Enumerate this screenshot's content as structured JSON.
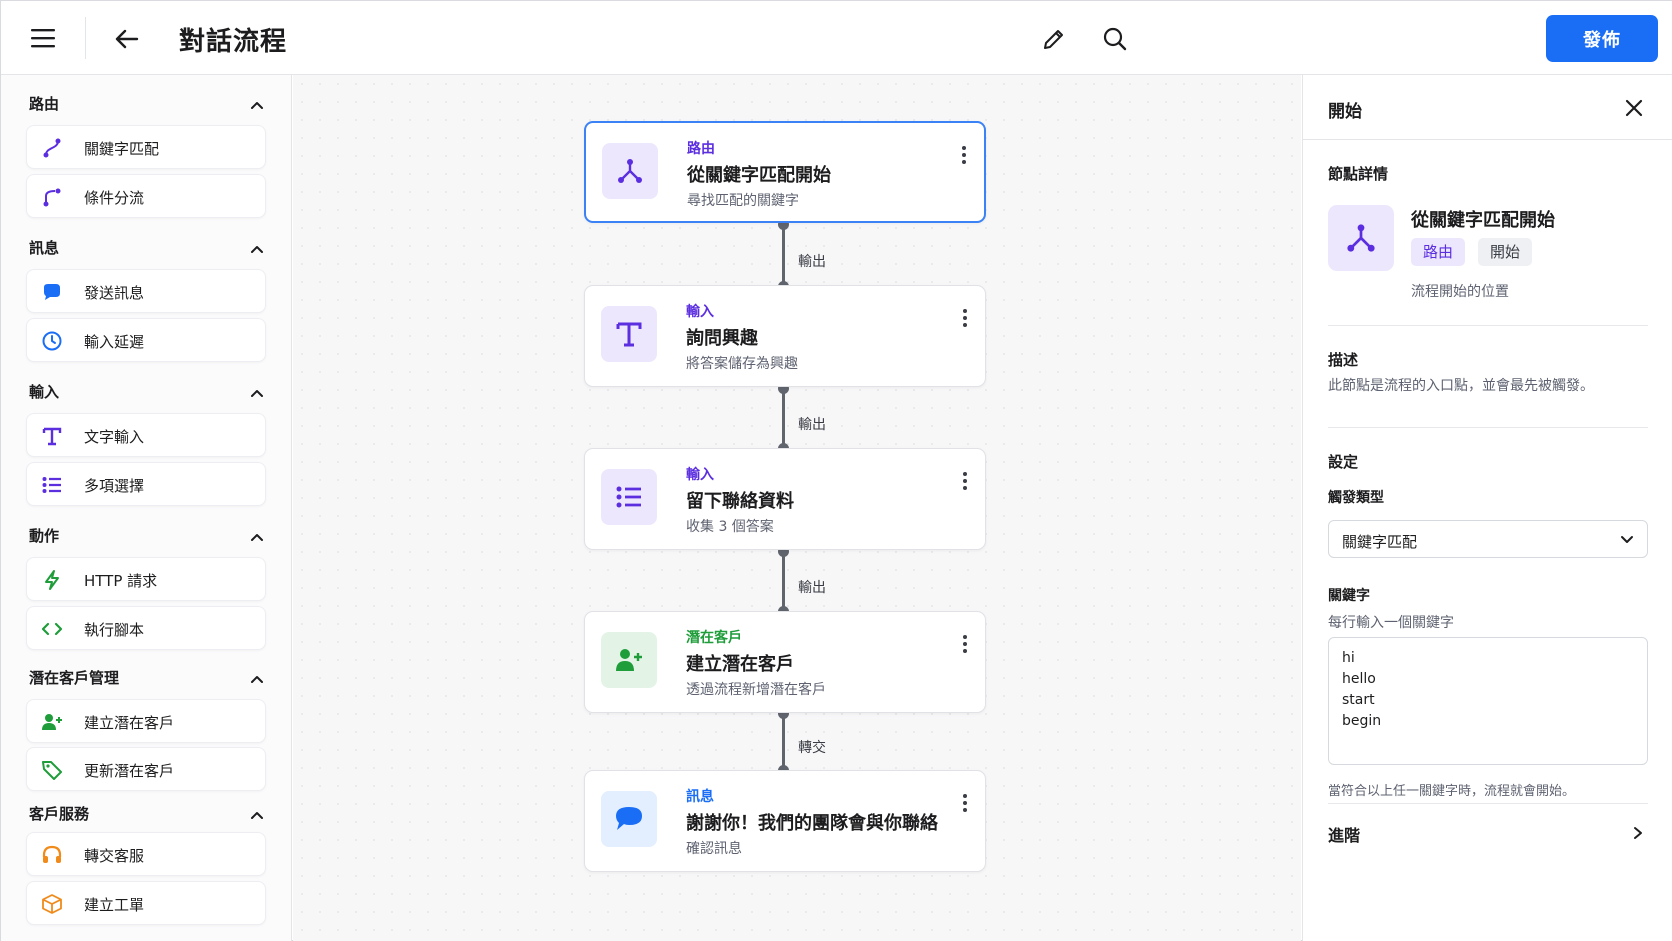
{
  "header": {
    "title": "對話流程",
    "publish_label": "發佈"
  },
  "sidebar": {
    "sections": [
      {
        "title": "路由",
        "items": [
          {
            "label": "關鍵字匹配",
            "icon": "route-icon"
          },
          {
            "label": "條件分流",
            "icon": "branch-icon"
          }
        ]
      },
      {
        "title": "訊息",
        "items": [
          {
            "label": "發送訊息",
            "icon": "chat-bubble-icon"
          },
          {
            "label": "輸入延遲",
            "icon": "clock-icon"
          }
        ]
      },
      {
        "title": "輸入",
        "items": [
          {
            "label": "文字輸入",
            "icon": "text-icon"
          },
          {
            "label": "多項選擇",
            "icon": "list-icon"
          }
        ]
      },
      {
        "title": "動作",
        "items": [
          {
            "label": "HTTP 請求",
            "icon": "lightning-icon"
          },
          {
            "label": "執行腳本",
            "icon": "code-icon"
          }
        ]
      },
      {
        "title": "潛在客戶管理",
        "items": [
          {
            "label": "建立潛在客戶",
            "icon": "add-user-icon"
          },
          {
            "label": "更新潛在客戶",
            "icon": "tag-icon"
          }
        ]
      },
      {
        "title": "客戶服務",
        "items": [
          {
            "label": "轉交客服",
            "icon": "headset-icon"
          },
          {
            "label": "建立工單",
            "icon": "box-icon"
          }
        ]
      }
    ]
  },
  "flow": {
    "nodes": [
      {
        "category": "路由",
        "title": "從關鍵字匹配開始",
        "subtitle": "尋找匹配的關鍵字",
        "icon": "route-icon"
      },
      {
        "category": "輸入",
        "title": "詢問興趣",
        "subtitle": "將答案儲存為興趣",
        "icon": "text-icon"
      },
      {
        "category": "輸入",
        "title": "留下聯絡資料",
        "subtitle": "收集 3 個答案",
        "icon": "list-icon"
      },
      {
        "category": "潛在客戶",
        "title": "建立潛在客戶",
        "subtitle": "透過流程新增潛在客戶",
        "icon": "add-user-icon"
      },
      {
        "category": "訊息",
        "title": "謝謝你！我們的團隊會與你聯絡",
        "subtitle": "確認訊息",
        "icon": "chat-bubble-icon"
      }
    ],
    "edges": [
      "輸出",
      "輸出",
      "輸出",
      "轉交"
    ]
  },
  "panel": {
    "title": "開始",
    "details_label": "節點詳情",
    "node_title": "從關鍵字匹配開始",
    "tag_category": "路由",
    "tag_type": "開始",
    "node_desc": "流程開始的位置",
    "description_label": "描述",
    "description_text": "此節點是流程的入口點，並會最先被觸發。",
    "settings_label": "設定",
    "trigger_label": "觸發類型",
    "trigger_value": "關鍵字匹配",
    "keywords_label": "關鍵字",
    "keywords_hint": "每行輸入一個關鍵字",
    "keywords_value": "hi\nhello\nstart\nbegin",
    "keywords_note": "當符合以上任一關鍵字時，流程就會開始。",
    "advanced_label": "進階"
  },
  "colors": {
    "accent": "#1a6ef5",
    "route_purple": "#5b2ee0",
    "input_purple": "#5b2ee0",
    "lead_green": "#1f9d3a",
    "message_blue": "#1a6ef5",
    "node_border_selected": "#3b82f6"
  }
}
